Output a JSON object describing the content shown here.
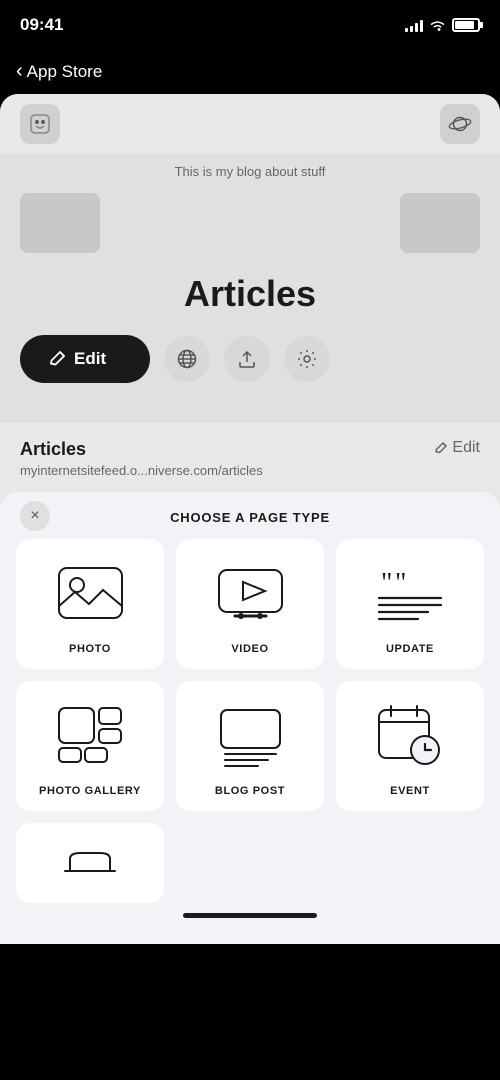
{
  "statusBar": {
    "time": "09:41",
    "signalBars": [
      4,
      6,
      8,
      10,
      12
    ],
    "batteryLevel": 85
  },
  "navBar": {
    "backLabel": "App Store",
    "backIcon": "‹"
  },
  "appTopBar": {
    "leftIconAlt": "smiley-icon",
    "rightIconAlt": "planet-icon"
  },
  "pageContent": {
    "subtitle": "This is my blog about stuff",
    "title": "Articles",
    "editButtonLabel": "Edit",
    "editIcon": "✎"
  },
  "pageInfo": {
    "name": "Articles",
    "url": "myinternetsitefeed.o...niverse.com/articles",
    "editLabel": "Edit",
    "editIcon": "✎"
  },
  "bottomSheet": {
    "title": "CHOOSE A PAGE TYPE",
    "closeIcon": "×",
    "pageTypes": [
      {
        "id": "photo",
        "label": "PHOTO"
      },
      {
        "id": "video",
        "label": "VIDEO"
      },
      {
        "id": "update",
        "label": "UPDATE"
      },
      {
        "id": "photo-gallery",
        "label": "PHOTO GALLERY"
      },
      {
        "id": "blog-post",
        "label": "BLOG POST"
      },
      {
        "id": "event",
        "label": "EVENT"
      }
    ],
    "partialTypes": [
      {
        "id": "store",
        "label": ""
      }
    ]
  }
}
